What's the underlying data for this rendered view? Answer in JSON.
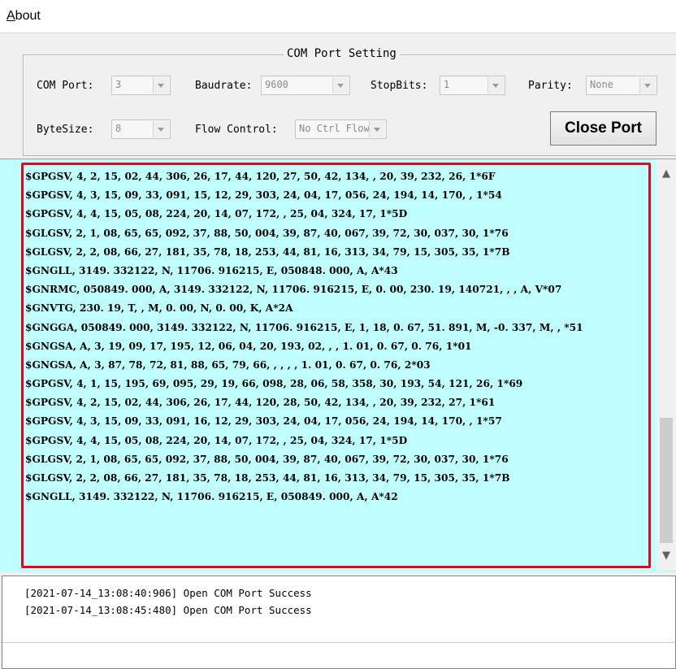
{
  "menu": {
    "about_first": "A",
    "about_rest": "bout"
  },
  "com_settings": {
    "title": "COM Port Setting",
    "com_port_label": "COM Port:",
    "com_port_value": "3",
    "baudrate_label": "Baudrate:",
    "baudrate_value": "9600",
    "stopbits_label": "StopBits:",
    "stopbits_value": "1",
    "parity_label": "Parity:",
    "parity_value": "None",
    "bytesize_label": "ByteSize:",
    "bytesize_value": "8",
    "flow_control_label": "Flow Control:",
    "flow_control_value": "No Ctrl Flow",
    "close_button": "Close Port"
  },
  "nmea_lines": [
    "$GPGSV, 4, 2, 15, 02, 44, 306, 26, 17, 44, 120, 27, 50, 42, 134, , 20, 39, 232, 26, 1*6F",
    "$GPGSV, 4, 3, 15, 09, 33, 091, 15, 12, 29, 303, 24, 04, 17, 056, 24, 194, 14, 170, , 1*54",
    "$GPGSV, 4, 4, 15, 05, 08, 224, 20, 14, 07, 172, , 25, 04, 324, 17, 1*5D",
    "$GLGSV, 2, 1, 08, 65, 65, 092, 37, 88, 50, 004, 39, 87, 40, 067, 39, 72, 30, 037, 30, 1*76",
    "$GLGSV, 2, 2, 08, 66, 27, 181, 35, 78, 18, 253, 44, 81, 16, 313, 34, 79, 15, 305, 35, 1*7B",
    "$GNGLL, 3149. 332122, N, 11706. 916215, E, 050848. 000, A, A*43",
    "$GNRMC, 050849. 000, A, 3149. 332122, N, 11706. 916215, E, 0. 00, 230. 19, 140721, , , A, V*07",
    "$GNVTG, 230. 19, T, , M, 0. 00, N, 0. 00, K, A*2A",
    "$GNGGA, 050849. 000, 3149. 332122, N, 11706. 916215, E, 1, 18, 0. 67, 51. 891, M, -0. 337, M, , *51",
    "$GNGSA, A, 3, 19, 09, 17, 195, 12, 06, 04, 20, 193, 02, , , 1. 01, 0. 67, 0. 76, 1*01",
    "$GNGSA, A, 3, 87, 78, 72, 81, 88, 65, 79, 66, , , , , 1. 01, 0. 67, 0. 76, 2*03",
    "$GPGSV, 4, 1, 15, 195, 69, 095, 29, 19, 66, 098, 28, 06, 58, 358, 30, 193, 54, 121, 26, 1*69",
    "$GPGSV, 4, 2, 15, 02, 44, 306, 26, 17, 44, 120, 28, 50, 42, 134, , 20, 39, 232, 27, 1*61",
    "$GPGSV, 4, 3, 15, 09, 33, 091, 16, 12, 29, 303, 24, 04, 17, 056, 24, 194, 14, 170, , 1*57",
    "$GPGSV, 4, 4, 15, 05, 08, 224, 20, 14, 07, 172, , 25, 04, 324, 17, 1*5D",
    "$GLGSV, 2, 1, 08, 65, 65, 092, 37, 88, 50, 004, 39, 87, 40, 067, 39, 72, 30, 037, 30, 1*76",
    "$GLGSV, 2, 2, 08, 66, 27, 181, 35, 78, 18, 253, 44, 81, 16, 313, 34, 79, 15, 305, 35, 1*7B",
    "$GNGLL, 3149. 332122, N, 11706. 916215, E, 050849. 000, A, A*42"
  ],
  "log_lines": [
    "[2021-07-14_13:08:40:906] Open COM Port Success",
    "[2021-07-14_13:08:45:480] Open COM Port Success"
  ],
  "scrollbar": {
    "up_icon": "▲",
    "down_icon": "▼"
  },
  "colors": {
    "data_background": "#c0ffff",
    "highlight_border": "#e8001c"
  }
}
